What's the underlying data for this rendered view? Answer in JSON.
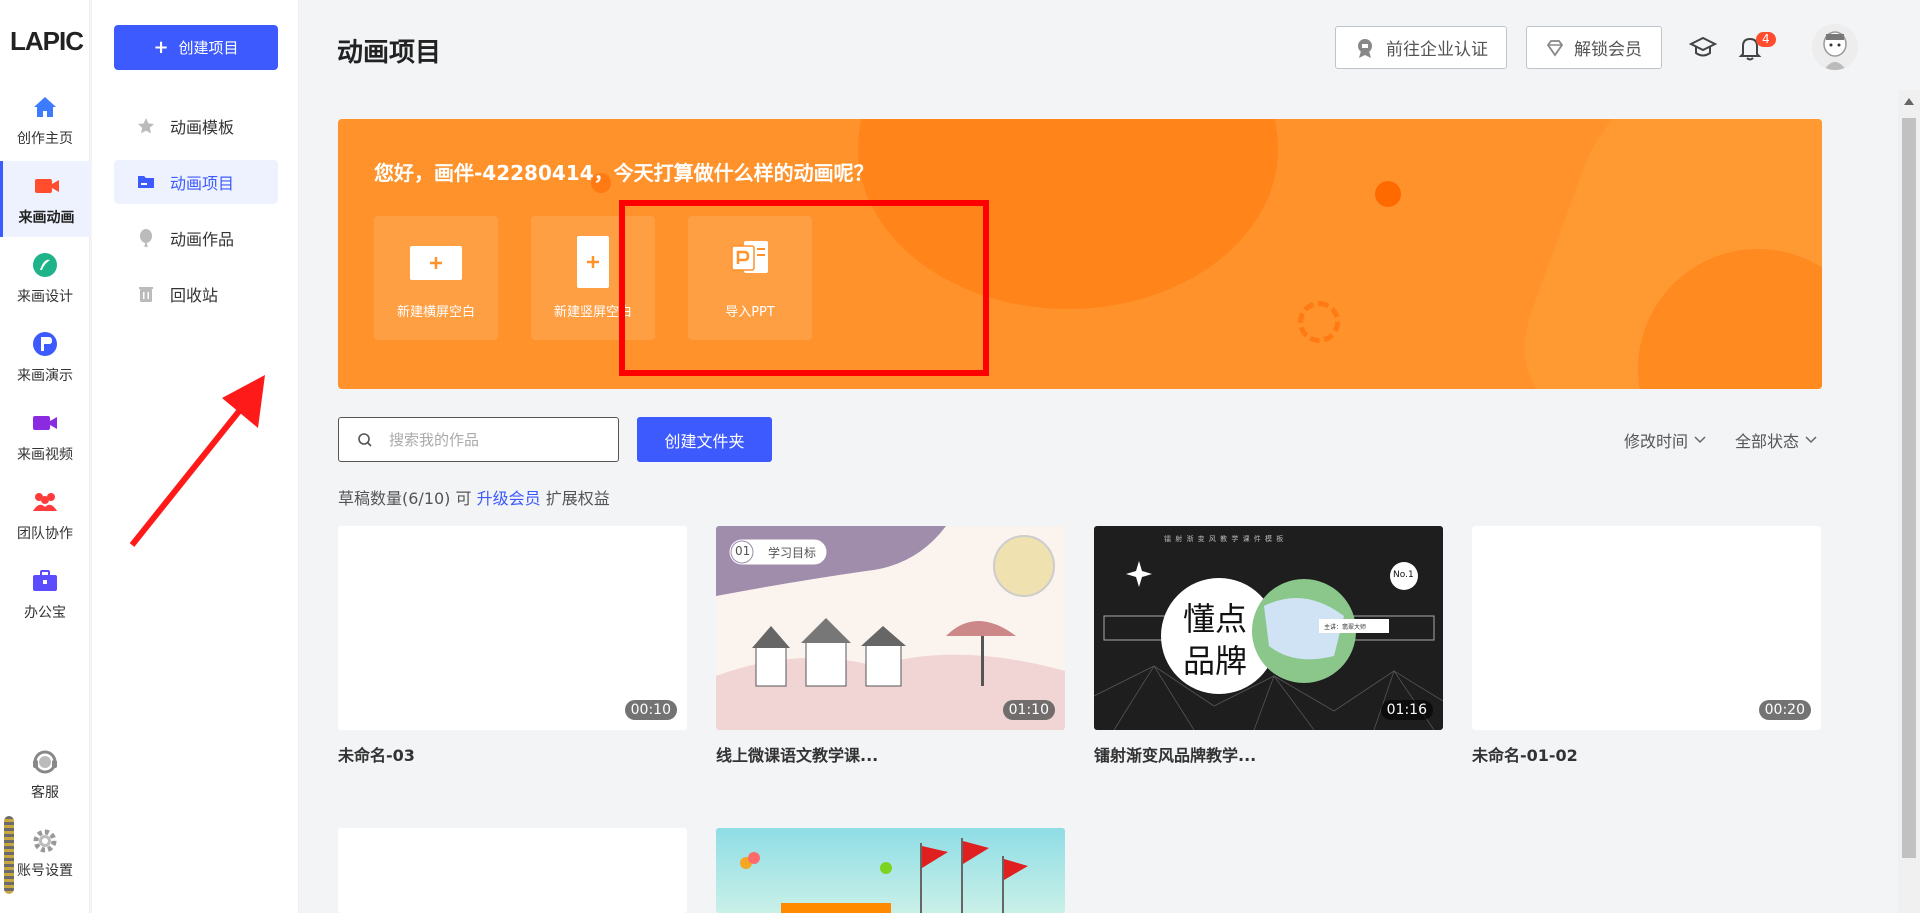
{
  "logo": "LAPIC",
  "rail": {
    "items": [
      {
        "label": "创作主页",
        "icon": "home-icon"
      },
      {
        "label": "来画动画",
        "icon": "video-camera-icon"
      },
      {
        "label": "来画设计",
        "icon": "design-icon"
      },
      {
        "label": "来画演示",
        "icon": "presentation-icon"
      },
      {
        "label": "来画视频",
        "icon": "video-icon"
      },
      {
        "label": "团队协作",
        "icon": "team-icon"
      },
      {
        "label": "办公宝",
        "icon": "briefcase-icon"
      }
    ],
    "active_index": 1,
    "bottom": [
      {
        "label": "客服",
        "icon": "headset-icon"
      },
      {
        "label": "账号设置",
        "icon": "gear-icon"
      }
    ]
  },
  "sidenav": {
    "create_label": "创建项目",
    "items": [
      {
        "label": "动画模板",
        "icon": "star-icon"
      },
      {
        "label": "动画项目",
        "icon": "folder-icon"
      },
      {
        "label": "动画作品",
        "icon": "balloon-icon"
      },
      {
        "label": "回收站",
        "icon": "trash-icon"
      }
    ],
    "active_index": 1
  },
  "header": {
    "title": "动画项目",
    "enterprise_label": "前往企业认证",
    "vip_label": "解锁会员",
    "notification_count": "4"
  },
  "banner": {
    "greeting": "您好，画伴-42280414，今天打算做什么样的动画呢？",
    "actions": [
      {
        "label": "新建横屏空白",
        "icon": "landscape-canvas-icon"
      },
      {
        "label": "新建竖屏空白",
        "icon": "portrait-canvas-icon"
      },
      {
        "label": "导入PPT",
        "icon": "ppt-icon"
      }
    ]
  },
  "toolbar": {
    "search_placeholder": "搜索我的作品",
    "folder_label": "创建文件夹",
    "sort_label": "修改时间",
    "status_label": "全部状态"
  },
  "draft_info": {
    "prefix": "草稿数量(6/10) 可",
    "link": "升级会员",
    "suffix": "扩展权益"
  },
  "projects": [
    {
      "title": "未命名-03",
      "duration": "00:10"
    },
    {
      "title": "线上微课语文教学课...",
      "duration": "01:10",
      "thumb_text": "学习目标",
      "thumb_num": "01"
    },
    {
      "title": "镭射渐变风品牌教学...",
      "duration": "01:16",
      "thumb_text_1": "懂点",
      "thumb_text_2": "品牌",
      "thumb_header": "镭 射 渐 变 风 教 学 课 件 模 板",
      "thumb_badge": "No.1",
      "thumb_caption": "主讲：翡翠大师"
    },
    {
      "title": "未命名-01-02",
      "duration": "00:20"
    },
    {
      "title": "",
      "duration": ""
    },
    {
      "title": "",
      "duration": ""
    }
  ],
  "colors": {
    "accent": "#3d5afe",
    "banner": "#ff922b",
    "highlight": "#ff0000"
  }
}
